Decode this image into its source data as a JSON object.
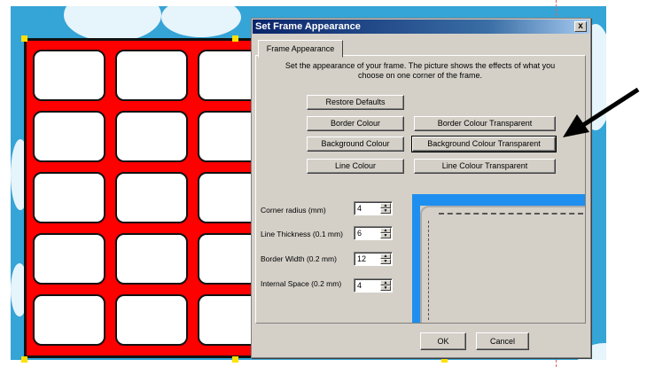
{
  "dialog": {
    "title": "Set Frame Appearance",
    "close_glyph": "x",
    "tab_label": "Frame Appearance",
    "instructions": "Set the appearance of your frame. The picture shows the effects of what you choose on one corner of the frame.",
    "buttons": {
      "restore_defaults": "Restore Defaults",
      "border_colour": "Border Colour",
      "border_colour_transparent": "Border Colour Transparent",
      "background_colour": "Background Colour",
      "background_colour_transparent": "Background Colour Transparent",
      "line_colour": "Line Colour",
      "line_colour_transparent": "Line Colour Transparent",
      "ok": "OK",
      "cancel": "Cancel"
    },
    "fields": {
      "corner_radius": {
        "label": "Corner radius (mm)",
        "value": "4"
      },
      "line_thickness": {
        "label": "Line Thickness (0.1 mm)",
        "value": "6"
      },
      "border_width": {
        "label": "Border Width (0.2 mm)",
        "value": "12"
      },
      "internal_space": {
        "label": "Internal Space (0.2 mm)",
        "value": "4"
      }
    }
  },
  "colors": {
    "frame_background": "#ff0000",
    "canvas_background": "#35a4d6",
    "preview_border": "#1e8fef",
    "selection_handle": "#ffe000"
  },
  "icons": [
    "close-icon",
    "spin-up-icon",
    "spin-down-icon",
    "pointer-arrow-icon"
  ]
}
